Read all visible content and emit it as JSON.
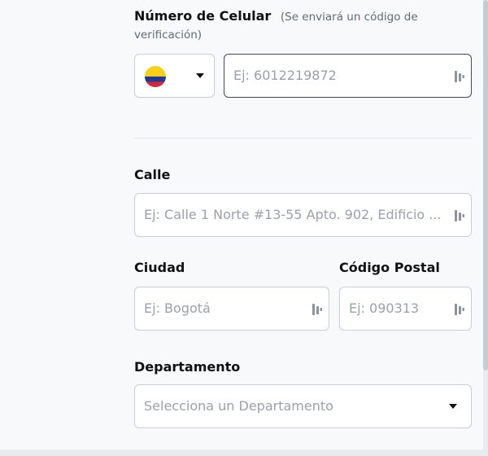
{
  "phone": {
    "label": "Número de Celular",
    "hint_line1": "(Se enviará un código de",
    "hint_line2": "verificación)",
    "country_flag_icon": "colombia-flag-icon",
    "placeholder": "Ej: 6012219872"
  },
  "street": {
    "label": "Calle",
    "placeholder": "Ej: Calle 1 Norte #13-55 Apto. 902, Edificio ..."
  },
  "city": {
    "label": "Ciudad",
    "placeholder": "Ej: Bogotá"
  },
  "postal": {
    "label": "Código Postal",
    "placeholder": "Ej: 090313"
  },
  "department": {
    "label": "Departamento",
    "placeholder": "Selecciona un Departamento"
  },
  "icons": {
    "autofill": "password-manager-key-icon",
    "dropdown": "caret-down-icon"
  },
  "colors": {
    "focused_border": "#3c4a5e",
    "flag_yellow": "#f7d117",
    "flag_blue": "#1f3a93",
    "flag_red": "#d9233a"
  }
}
